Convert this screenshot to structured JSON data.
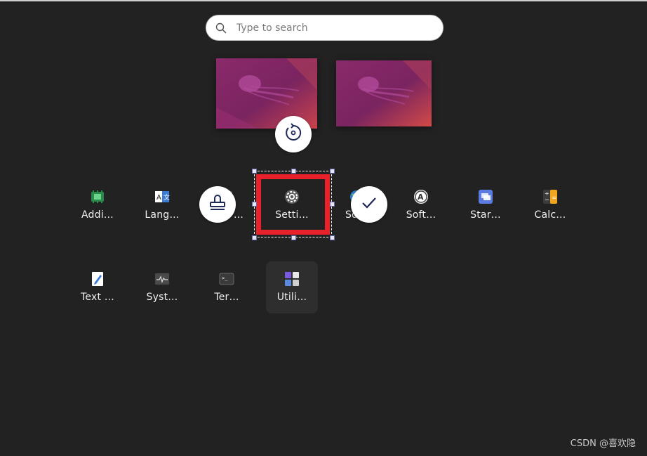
{
  "search": {
    "placeholder": "Type to search"
  },
  "apps_row1": [
    {
      "label": "Addi…",
      "icon": "addons-icon"
    },
    {
      "label": "Lang…",
      "icon": "language-icon"
    },
    {
      "label": "…",
      "icon": "hidden-app-icon"
    },
    {
      "label": "Setti…",
      "icon": "settings-gear-icon"
    },
    {
      "label": "So…",
      "icon": "software-globe-icon"
    },
    {
      "label": "Soft…",
      "icon": "software-updater-icon"
    },
    {
      "label": "Star…",
      "icon": "startup-disk-icon"
    },
    {
      "label": "Calc…",
      "icon": "calculator-icon"
    }
  ],
  "apps_row2": [
    {
      "label": "Text …",
      "icon": "text-editor-icon"
    },
    {
      "label": "Syst…",
      "icon": "system-monitor-icon"
    },
    {
      "label": "Ter…",
      "icon": "terminal-icon"
    },
    {
      "label": "Utili…",
      "icon": "utilities-folder-icon"
    }
  ],
  "overlay": {
    "highlight_color": "#e8212a",
    "tools": [
      "rotate-icon",
      "stamp-icon",
      "checkmark-icon"
    ]
  },
  "watermark": "CSDN @喜欢隐"
}
